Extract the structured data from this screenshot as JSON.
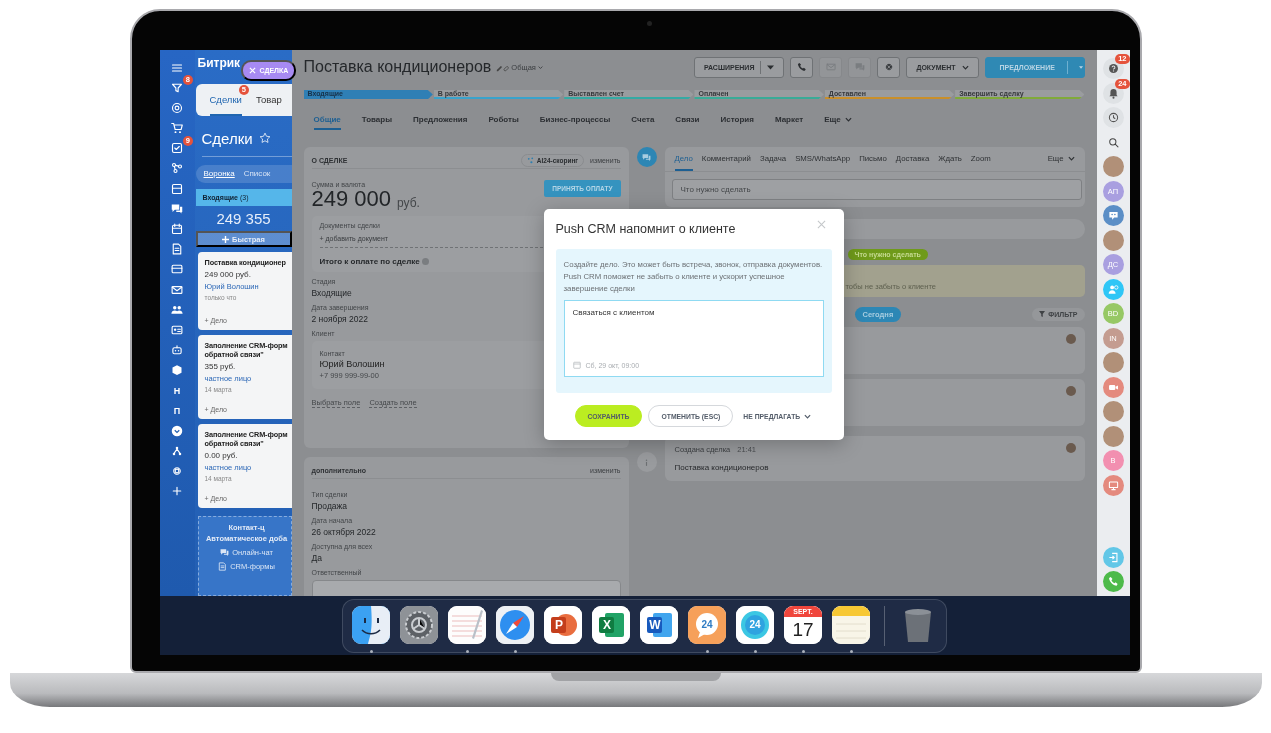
{
  "nav_rail": {
    "items": [
      {
        "kind": "menu"
      },
      {
        "kind": "funnel",
        "badge": "8"
      },
      {
        "kind": "target"
      },
      {
        "kind": "cart"
      },
      {
        "kind": "check",
        "badge": "9"
      },
      {
        "kind": "nodes"
      },
      {
        "kind": "panel"
      },
      {
        "kind": "chat"
      },
      {
        "kind": "calendar"
      },
      {
        "kind": "document"
      },
      {
        "kind": "terminal"
      },
      {
        "kind": "mail"
      },
      {
        "kind": "people"
      },
      {
        "kind": "idcard"
      },
      {
        "kind": "robot"
      },
      {
        "kind": "box"
      },
      {
        "kind": "letter",
        "text": "Н"
      },
      {
        "kind": "letter",
        "text": "П"
      },
      {
        "kind": "chevron"
      },
      {
        "kind": "tree"
      },
      {
        "kind": "gear"
      },
      {
        "kind": "plus"
      }
    ]
  },
  "kanban": {
    "brand": "Битрик",
    "close_chip": "СДЕЛКА",
    "tabs": [
      {
        "label": "Сделки",
        "badge": "5",
        "selected": true
      },
      {
        "label": "Товар",
        "selected": false
      }
    ],
    "title": "Сделки",
    "view_tabs": [
      {
        "label": "Воронка",
        "selected": true
      },
      {
        "label": "Список",
        "selected": false
      }
    ],
    "column": {
      "name": "Входящие",
      "count": "(3)",
      "total": "249 355",
      "quick_add": "Быстрая"
    },
    "cards": [
      {
        "title_lines": [
          "Поставка кондиционер"
        ],
        "amount": "249 000 руб.",
        "client": "Юрий Волошин",
        "time": "только что",
        "action": "+ Дело"
      },
      {
        "title_lines": [
          "Заполнение CRM-форм",
          "обратной связи\""
        ],
        "amount": "355 руб.",
        "client": "частное лицо",
        "time": "14 марта",
        "action": "+ Дело"
      },
      {
        "title_lines": [
          "Заполнение CRM-форм",
          "обратной связи\""
        ],
        "amount": "0.00 руб.",
        "client": "частное лицо",
        "time": "14 марта",
        "action": "+ Дело"
      }
    ],
    "footer": {
      "title": "Контакт-ц",
      "subtitle": "Автоматическое доба",
      "items": [
        {
          "kind": "chat",
          "label": "Онлайн-чат"
        },
        {
          "kind": "form",
          "label": "CRM-формы"
        }
      ]
    }
  },
  "deal": {
    "title": "Поставка кондиционеров",
    "category": "Общая",
    "toolbar": [
      {
        "kind": "split",
        "label": "РАСШИРЕНИЯ",
        "disabled": false
      },
      {
        "kind": "phone",
        "disabled": false
      },
      {
        "kind": "mail",
        "disabled": true
      },
      {
        "kind": "chat",
        "disabled": true
      },
      {
        "kind": "gear",
        "disabled": false
      },
      {
        "kind": "dropdown",
        "label": "ДОКУМЕНТ",
        "disabled": false
      },
      {
        "kind": "primary",
        "label": "ПРЕДЛОЖЕНИЕ",
        "disabled": false
      }
    ],
    "stages": [
      {
        "label": "Входящие",
        "color": "#2f7fb5",
        "selected": true
      },
      {
        "label": "В работе",
        "color": "#3aa3cc",
        "selected": false
      },
      {
        "label": "Выставлен счет",
        "color": "#35aaa4",
        "selected": false
      },
      {
        "label": "Оплачен",
        "color": "#3aab97",
        "selected": false
      },
      {
        "label": "Доставлен",
        "color": "#c98f2a",
        "selected": false
      },
      {
        "label": "Завершить сделку",
        "color": "#80aa3a",
        "selected": false
      }
    ],
    "tabs": [
      {
        "label": "Общие",
        "selected": true
      },
      {
        "label": "Товары",
        "selected": false
      },
      {
        "label": "Предложения",
        "selected": false
      },
      {
        "label": "Роботы",
        "selected": false
      },
      {
        "label": "Бизнес-процессы",
        "selected": false
      },
      {
        "label": "Счета",
        "selected": false
      },
      {
        "label": "Связи",
        "selected": false
      },
      {
        "label": "История",
        "selected": false
      },
      {
        "label": "Маркет",
        "selected": false
      },
      {
        "label": "Еще",
        "selected": false
      }
    ],
    "about": {
      "heading": "О СДЕЛКЕ",
      "scoring": "AI24-скоринг",
      "edit": "изменить",
      "amount_label": "Сумма и валюта",
      "amount": "249 000",
      "currency": "руб.",
      "pay_button": "ПРИНЯТЬ ОПЛАТУ",
      "documents": {
        "label": "Документы сделки",
        "add": "+ добавить документ",
        "total": "Итого к оплате по сделке"
      },
      "fields": [
        {
          "label": "Стадия",
          "value": "Входящие"
        },
        {
          "label": "Дата завершения",
          "value": "2 ноября 2022"
        }
      ],
      "client_label": "Клиент",
      "contact": {
        "label": "Контакт",
        "name": "Юрий Волошин",
        "phone": "+7 999 999-99-00"
      },
      "links": [
        "Выбрать поле",
        "Создать поле"
      ]
    },
    "extra": {
      "heading": "дополнительно",
      "edit": "изменить",
      "fields": [
        {
          "label": "Тип сделки",
          "value": "Продажа"
        },
        {
          "label": "Дата начала",
          "value": "26 октября 2022"
        },
        {
          "label": "Доступна для всех",
          "value": "Да"
        }
      ],
      "responsible_label": "Ответственный"
    },
    "timeline": {
      "tabs": [
        {
          "label": "Дело",
          "selected": true
        },
        {
          "label": "Комментарий",
          "selected": false
        },
        {
          "label": "Задача",
          "selected": false
        },
        {
          "label": "SMS/WhatsApp",
          "selected": false
        },
        {
          "label": "Письмо",
          "selected": false
        },
        {
          "label": "Доставка",
          "selected": false
        },
        {
          "label": "Ждать",
          "selected": false
        },
        {
          "label": "Zoom",
          "selected": false
        }
      ],
      "more": "Еще",
      "placeholder": "Что нужно сделать",
      "todo_pill": "Что нужно сделать",
      "hint": "тобы не забыть о клиенте",
      "today": "Сегодня",
      "filter": "ФИЛЬТР",
      "items": [
        {
          "kind": "activity"
        },
        {
          "kind": "activity"
        },
        {
          "kind": "event",
          "title": "Создана сделка",
          "time": "21:41",
          "text": "Поставка кондиционеров"
        }
      ]
    }
  },
  "modal": {
    "title": "Push CRM напомнит о клиенте",
    "description": "Создайте дело. Это может быть встреча, звонок, отправка документов. Push CRM поможет не забыть о клиенте и ускорит успешное завершение сделки",
    "value": "Связаться с клиентом",
    "deadline": "Сб, 29 окт, 09:00",
    "buttons": [
      {
        "kind": "primary",
        "label": "СОХРАНИТЬ"
      },
      {
        "kind": "secondary",
        "label": "ОТМЕНИТЬ (ESC)"
      },
      {
        "kind": "menu",
        "label": "НЕ ПРЕДЛАГАТЬ"
      }
    ]
  },
  "right_rail": {
    "items": [
      {
        "kind": "help",
        "badge": "12"
      },
      {
        "kind": "bell",
        "badge": "24"
      },
      {
        "kind": "chatclock"
      },
      {
        "kind": "search"
      },
      {
        "kind": "photo"
      },
      {
        "kind": "initials",
        "text": "АП",
        "color": "#a99fe0"
      },
      {
        "kind": "group"
      },
      {
        "kind": "photo"
      },
      {
        "kind": "initials",
        "text": "ДС",
        "color": "#a99fe0"
      },
      {
        "kind": "userclock"
      },
      {
        "kind": "initials",
        "text": "BD",
        "color": "#97c865"
      },
      {
        "kind": "initials",
        "text": "IN",
        "color": "#c49c90"
      },
      {
        "kind": "photo"
      },
      {
        "kind": "video"
      },
      {
        "kind": "photo"
      },
      {
        "kind": "photo"
      },
      {
        "kind": "initials",
        "text": "B",
        "color": "#f28fb0"
      },
      {
        "kind": "board"
      },
      {
        "kind": "exit"
      },
      {
        "kind": "phone"
      }
    ]
  },
  "dock": {
    "apps": [
      {
        "kind": "finder",
        "running": true
      },
      {
        "kind": "settings",
        "running": false
      },
      {
        "kind": "textedit",
        "running": true
      },
      {
        "kind": "safari",
        "running": true
      },
      {
        "kind": "powerpoint",
        "letter": "P",
        "running": false
      },
      {
        "kind": "excel",
        "letter": "X",
        "running": false
      },
      {
        "kind": "word",
        "letter": "W",
        "running": false
      },
      {
        "kind": "chat24",
        "letter": "24",
        "running": true
      },
      {
        "kind": "cloud24",
        "letter": "24",
        "running": true
      },
      {
        "kind": "calendar",
        "month": "SEPT.",
        "day": "17",
        "running": true
      },
      {
        "kind": "notes",
        "running": true
      },
      {
        "kind": "trash",
        "running": false
      }
    ]
  }
}
